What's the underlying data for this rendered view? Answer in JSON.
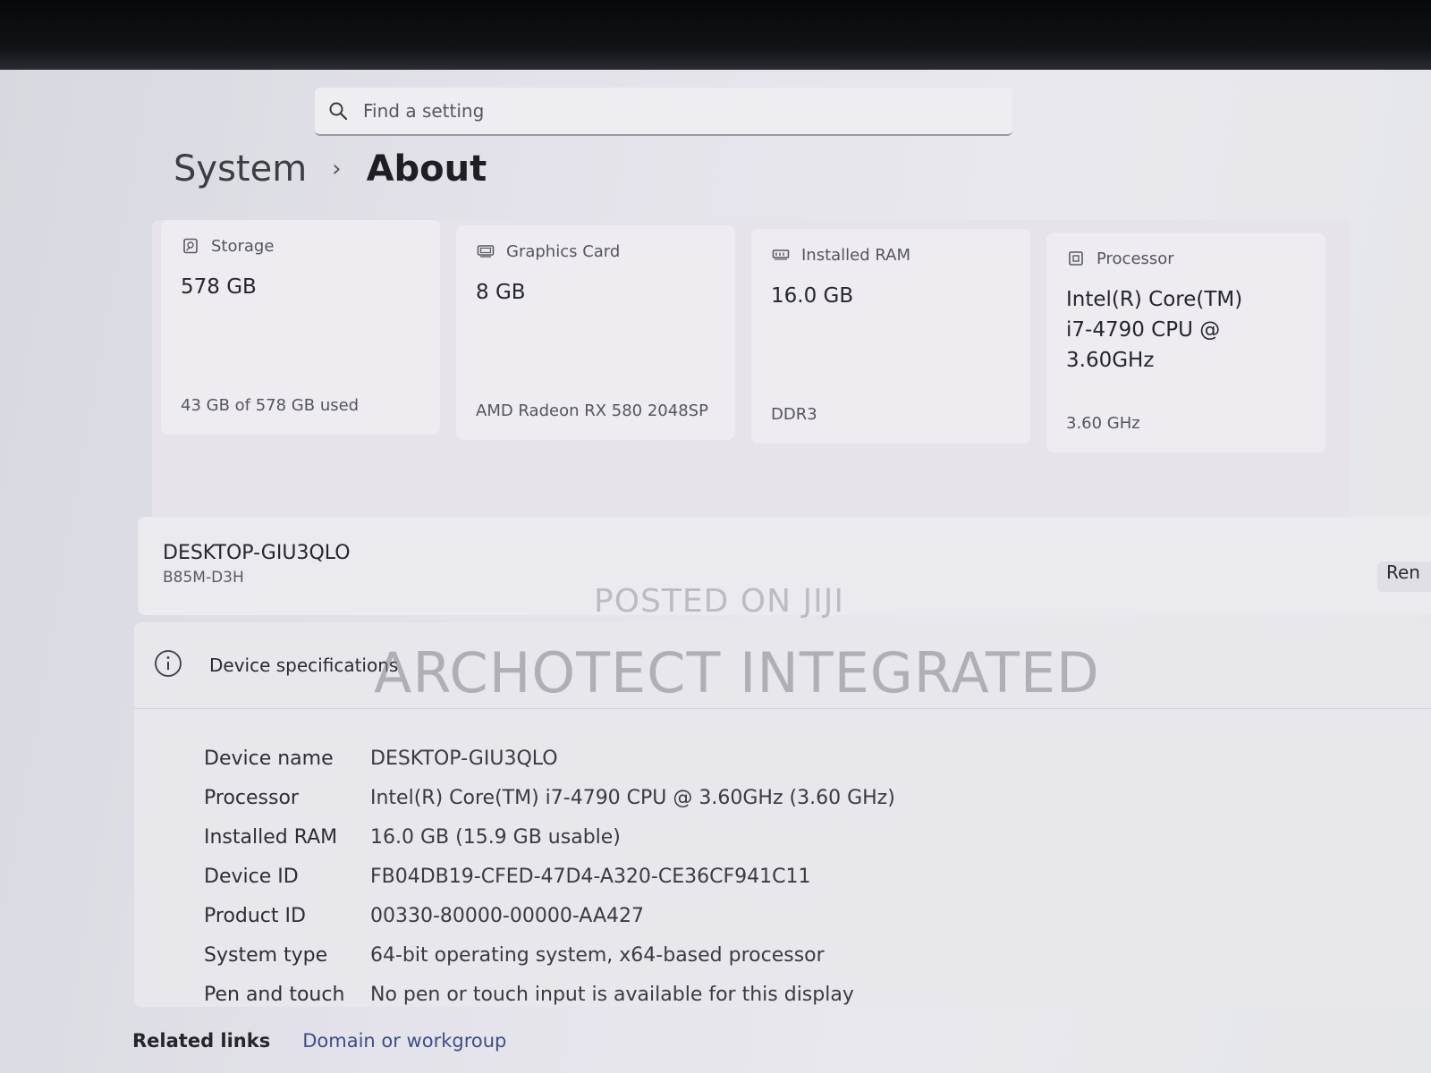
{
  "search": {
    "placeholder": "Find a setting",
    "icon": "search-icon"
  },
  "breadcrumb": {
    "parent": "System",
    "separator": "›",
    "current": "About"
  },
  "cards": [
    {
      "icon": "storage-icon",
      "label": "Storage",
      "value": "578 GB",
      "sub": "43 GB of 578 GB used"
    },
    {
      "icon": "graphics-card-icon",
      "label": "Graphics Card",
      "value": "8 GB",
      "sub": "AMD Radeon RX 580 2048SP"
    },
    {
      "icon": "ram-icon",
      "label": "Installed RAM",
      "value": "16.0 GB",
      "sub": "DDR3"
    },
    {
      "icon": "processor-icon",
      "label": "Processor",
      "value": "Intel(R) Core(TM) i7-4790 CPU @ 3.60GHz",
      "sub": "3.60 GHz"
    }
  ],
  "device": {
    "name": "DESKTOP-GIU3QLO",
    "model": "B85M-D3H",
    "rename_label": "Ren"
  },
  "specs": {
    "title": "Device specifications",
    "rows": [
      {
        "key": "Device name",
        "value": "DESKTOP-GIU3QLO"
      },
      {
        "key": "Processor",
        "value": "Intel(R) Core(TM) i7-4790 CPU @ 3.60GHz (3.60 GHz)"
      },
      {
        "key": "Installed RAM",
        "value": "16.0 GB (15.9 GB usable)"
      },
      {
        "key": "Device ID",
        "value": "FB04DB19-CFED-47D4-A320-CE36CF941C11"
      },
      {
        "key": "Product ID",
        "value": "00330-80000-00000-AA427"
      },
      {
        "key": "System type",
        "value": "64-bit operating system, x64-based processor"
      },
      {
        "key": "Pen and touch",
        "value": "No pen or touch input is available for this display"
      }
    ]
  },
  "related": {
    "title": "Related links",
    "first_link": "Domain or workgroup"
  },
  "watermarks": {
    "line1": "POSTED ON JIJI",
    "line2": "ARCHOTECT INTEGRATED"
  }
}
